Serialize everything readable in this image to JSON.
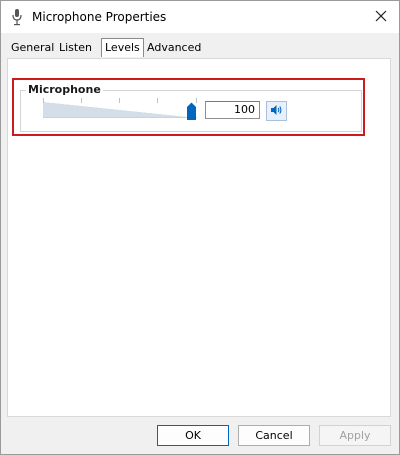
{
  "window": {
    "title": "Microphone Properties"
  },
  "tabs": [
    {
      "label": "General"
    },
    {
      "label": "Listen"
    },
    {
      "label": "Levels"
    },
    {
      "label": "Advanced"
    }
  ],
  "active_tab": "Levels",
  "levels": {
    "group_label": "Microphone",
    "slider_level_fraction": 1.0,
    "value": "100",
    "mute_icon": "speaker-icon"
  },
  "buttons": {
    "ok": "OK",
    "cancel": "Cancel",
    "apply": "Apply"
  },
  "colors": {
    "accent": "#0067c0",
    "highlight": "#cc1b1b",
    "thumb": "#0067c0"
  }
}
